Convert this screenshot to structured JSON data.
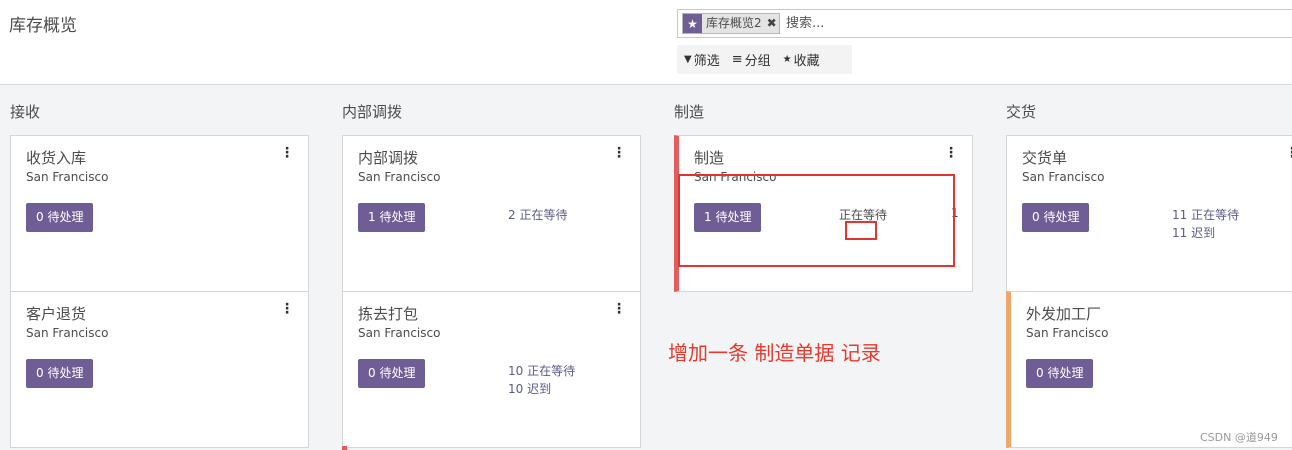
{
  "header": {
    "title": "库存概览",
    "search": {
      "facet_label": "库存概览2",
      "facet_close": "✖",
      "facet_icon": "star-icon",
      "placeholder": "搜索..."
    },
    "toolbar": {
      "filter_icon": "▼",
      "filter_label": "筛选",
      "group_icon": "≡",
      "group_label": "分组",
      "favorite_icon": "★",
      "favorite_label": "收藏"
    }
  },
  "columns": [
    {
      "title": "接收",
      "cards": [
        {
          "name": "收货入库",
          "location": "San Francisco",
          "todo": "0 待处理",
          "menu": "⋮"
        },
        {
          "name": "客户退货",
          "location": "San Francisco",
          "todo": "0 待处理",
          "menu": "⋮"
        }
      ]
    },
    {
      "title": "内部调拨",
      "cards": [
        {
          "name": "内部调拨",
          "location": "San Francisco",
          "todo": "1 待处理",
          "menu": "⋮",
          "waiting": "2 正在等待"
        },
        {
          "name": "拣去打包",
          "location": "San Francisco",
          "todo": "0 待处理",
          "menu": "⋮",
          "waiting": "10 正在等待",
          "late": "10 迟到"
        }
      ]
    },
    {
      "title": "制造",
      "cards": [
        {
          "name": "制造",
          "location": "San Francisco",
          "todo": "1 待处理",
          "menu": "⋮",
          "waiting": "正在等待",
          "extra": "1"
        }
      ]
    },
    {
      "title": "交货",
      "cards": [
        {
          "name": "交货单",
          "location": "San Francisco",
          "todo": "0 待处理",
          "menu": "⋮",
          "waiting": "11 正在等待",
          "late": "11 迟到"
        },
        {
          "name": "外发加工厂",
          "location": "San Francisco",
          "todo": "0 待处理",
          "menu": "⋮"
        }
      ]
    }
  ],
  "annotation": {
    "text": "增加一条 制造单据 记录",
    "color": "#e63a2e"
  },
  "watermark": "CSDN @道949",
  "colors": {
    "primary": "#6f5d96",
    "accent_red": "#e25d5d",
    "accent_orange": "#efa66a"
  }
}
